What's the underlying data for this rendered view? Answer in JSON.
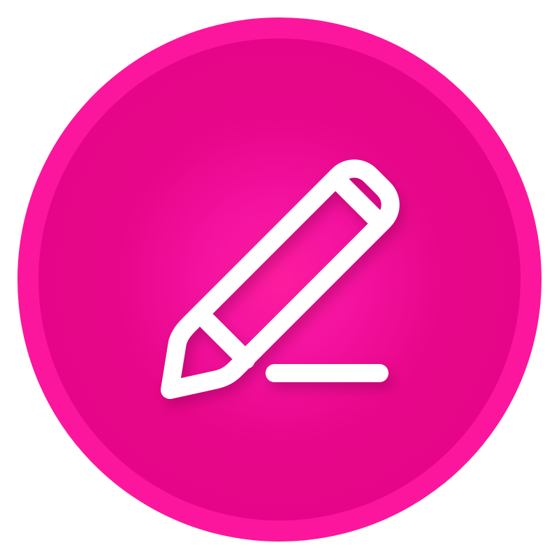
{
  "icon": {
    "name": "edit-pencil-icon",
    "colors": {
      "ring": "#fc169d",
      "fill_center": "#fd1c9e",
      "fill_edge": "#e40486",
      "glyph": "#ffffff"
    }
  }
}
